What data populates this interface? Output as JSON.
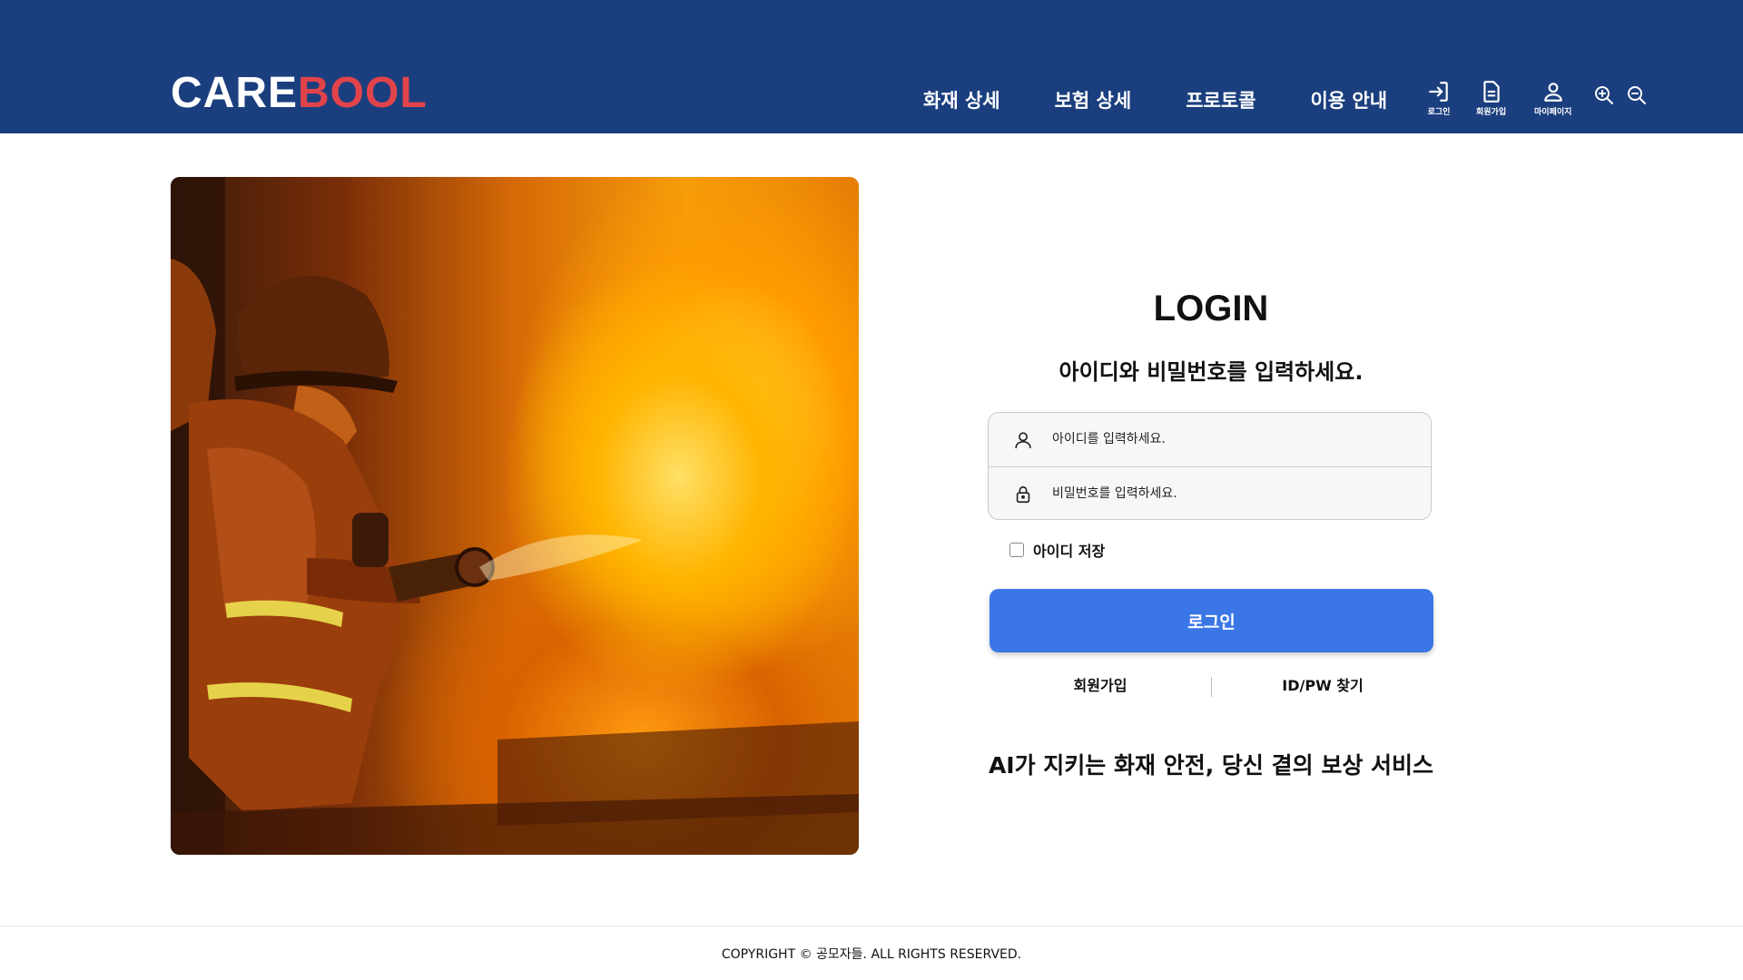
{
  "header": {
    "logo_primary": "CARE",
    "logo_accent": "BOOL",
    "logo_primary_color": "#ffffff",
    "logo_accent_color": "#e2434b",
    "background_color": "#1b3f7e",
    "nav": [
      {
        "label": "화재 상세"
      },
      {
        "label": "보험 상세"
      },
      {
        "label": "프로토콜"
      },
      {
        "label": "이용 안내"
      }
    ],
    "utilities": {
      "login": {
        "label": "로그인",
        "icon": "login-icon"
      },
      "signup": {
        "label": "회원가입",
        "icon": "document-icon"
      },
      "mypage": {
        "label": "마이페이지",
        "icon": "user-icon"
      },
      "zoom_in": {
        "icon": "zoom-in-icon"
      },
      "zoom_out": {
        "icon": "zoom-out-icon"
      }
    }
  },
  "hero": {
    "image": "firefighter-spraying-water-at-fire"
  },
  "login": {
    "title": "LOGIN",
    "subtitle": "아이디와 비밀번호를 입력하세요.",
    "id_placeholder": "아이디를 입력하세요.",
    "password_placeholder": "비밀번호를 입력하세요.",
    "remember_label": "아이디 저장",
    "submit_label": "로그인",
    "submit_color": "#3a76e6",
    "signup_link": "회원가입",
    "find_link": "ID/PW 찾기",
    "tagline": "AI가 지키는 화재 안전, 당신 곁의 보상 서비스"
  },
  "footer": {
    "copyright": "COPYRIGHT © 공모자들. ALL RIGHTS RESERVED."
  }
}
